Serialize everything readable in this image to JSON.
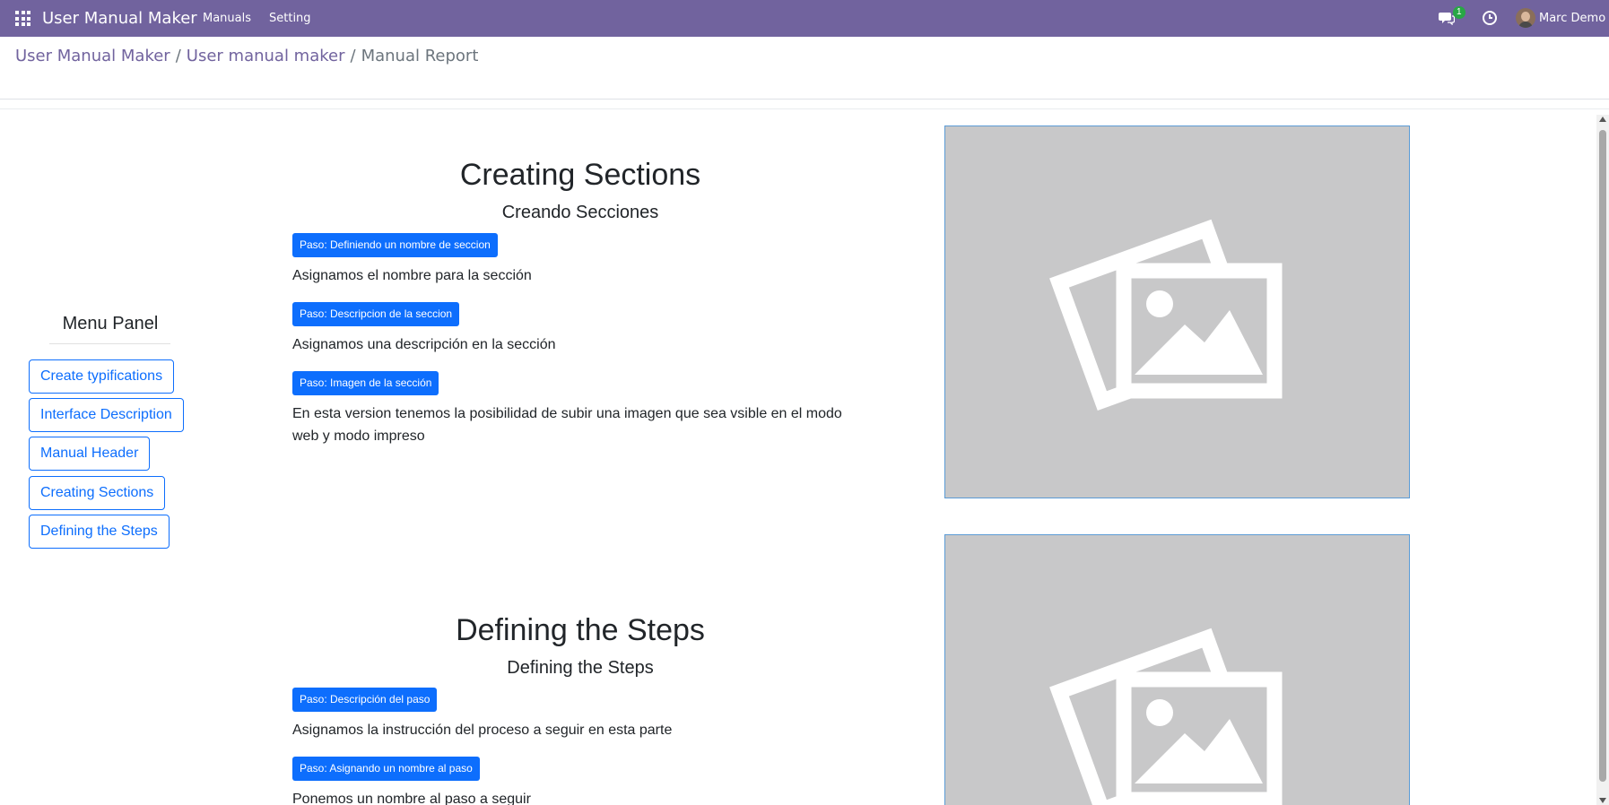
{
  "navbar": {
    "app_title": "User Manual Maker",
    "menu": [
      "Manuals",
      "Setting"
    ],
    "chat_badge": "1",
    "user_name": "Marc Demo",
    "bg_color": "#71639e"
  },
  "breadcrumb": {
    "items": [
      "User Manual Maker",
      "User manual maker",
      "Manual Report"
    ],
    "separator": "/"
  },
  "menu_panel": {
    "title": "Menu Panel",
    "items": [
      "Create typifications",
      "Interface Description",
      "Manual Header",
      "Creating Sections",
      "Defining the Steps"
    ]
  },
  "sections": [
    {
      "title": "Creating Sections",
      "subtitle": "Creando Secciones",
      "steps": [
        {
          "badge": "Paso: Definiendo un nombre de seccion",
          "text": "Asignamos el nombre para la sección"
        },
        {
          "badge": "Paso: Descripcion de la seccion",
          "text": "Asignamos una descripción en la sección"
        },
        {
          "badge": "Paso: Imagen de la sección",
          "text": "En esta version tenemos la posibilidad de subir una imagen que sea vsible en el modo web y modo impreso"
        }
      ]
    },
    {
      "title": "Defining the Steps",
      "subtitle": "Defining the Steps",
      "steps": [
        {
          "badge": "Paso: Descripción del paso",
          "text": "Asignamos la instrucción del proceso a seguir en esta parte"
        },
        {
          "badge": "Paso: Asignando un nombre al paso",
          "text": "Ponemos un nombre al paso a seguir"
        }
      ]
    }
  ],
  "colors": {
    "primary": "#0d6efd",
    "placeholder_bg": "#c8c8c9",
    "placeholder_border": "#5b9bd5"
  }
}
